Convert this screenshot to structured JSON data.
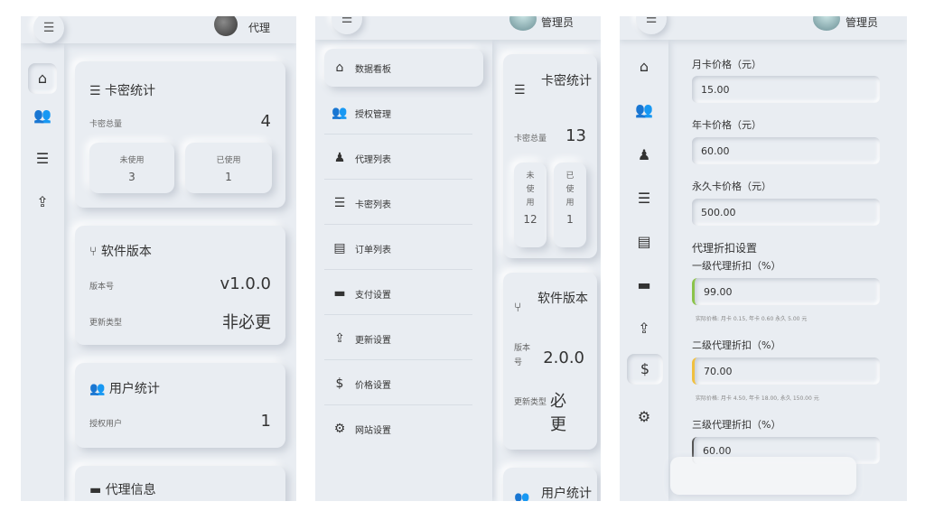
{
  "panel1": {
    "user": "代理",
    "stats_card": {
      "title": "卡密统计",
      "total_label": "卡密总量",
      "total_value": "4",
      "unused_label": "未使用",
      "unused_value": "3",
      "used_label": "已使用",
      "used_value": "1"
    },
    "version_card": {
      "title": "软件版本",
      "version_label": "版本号",
      "version_value": "v1.0.0",
      "type_label": "更新类型",
      "type_value": "非必更"
    },
    "user_card": {
      "title": "用户统计",
      "auth_label": "授权用户",
      "auth_value": "1"
    },
    "agent_card": {
      "title": "代理信息"
    }
  },
  "panel2": {
    "user": "管理员",
    "nav": [
      "数据看板",
      "授权管理",
      "代理列表",
      "卡密列表",
      "订单列表",
      "支付设置",
      "更新设置",
      "价格设置",
      "网站设置"
    ],
    "stats_card": {
      "title": "卡密统计",
      "total_label": "卡密总量",
      "total_value": "13",
      "unused_label": "未使用",
      "unused_value": "12",
      "used_label": "已使用",
      "used_value": "1"
    },
    "version_card": {
      "title": "软件版本",
      "version_label": "版本号",
      "version_value": "2.0.0",
      "type_label": "更新类型",
      "type_value": "必更"
    },
    "user_card": {
      "title": "用户统计"
    }
  },
  "panel3": {
    "user": "管理员",
    "fields": {
      "month_label": "月卡价格（元）",
      "month_value": "15.00",
      "year_label": "年卡价格（元）",
      "year_value": "60.00",
      "perm_label": "永久卡价格（元）",
      "perm_value": "500.00",
      "discount_title": "代理折扣设置",
      "lvl1_label": "一级代理折扣（%）",
      "lvl1_value": "99.00",
      "lvl1_hint": "实际价格: 月卡 0.15, 年卡 0.60 永久 5.00 元",
      "lvl2_label": "二级代理折扣（%）",
      "lvl2_value": "70.00",
      "lvl2_hint": "实际价格: 月卡 4.50, 年卡 18.00, 永久 150.00 元",
      "lvl3_label": "三级代理折扣（%）",
      "lvl3_value": "60.00"
    }
  },
  "colors": {
    "bg": "#e9edf2",
    "green_accent": "#8bc34a",
    "yellow_accent": "#f0c040"
  }
}
